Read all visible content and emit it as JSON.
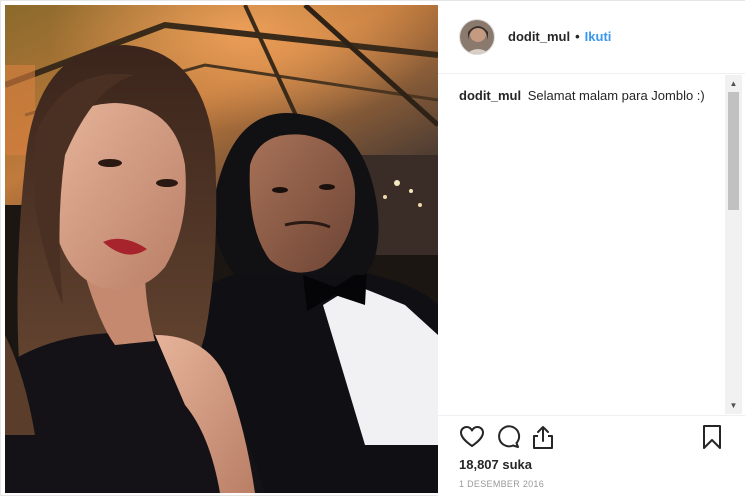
{
  "post": {
    "photo_alt": "",
    "header": {
      "username": "dodit_mul",
      "separator": "•",
      "follow_label": "Ikuti"
    },
    "caption": {
      "username": "dodit_mul",
      "text": "Selamat malam para Jomblo :)"
    },
    "actions": {
      "icons": [
        "heart-icon",
        "comment-icon",
        "share-icon",
        "bookmark-icon"
      ]
    },
    "likes": "18,807 suka",
    "date": "1 DESEMBER 2016"
  },
  "colors": {
    "link": "#3897f0",
    "text": "#262626",
    "muted": "#999999",
    "border": "#efefef"
  }
}
